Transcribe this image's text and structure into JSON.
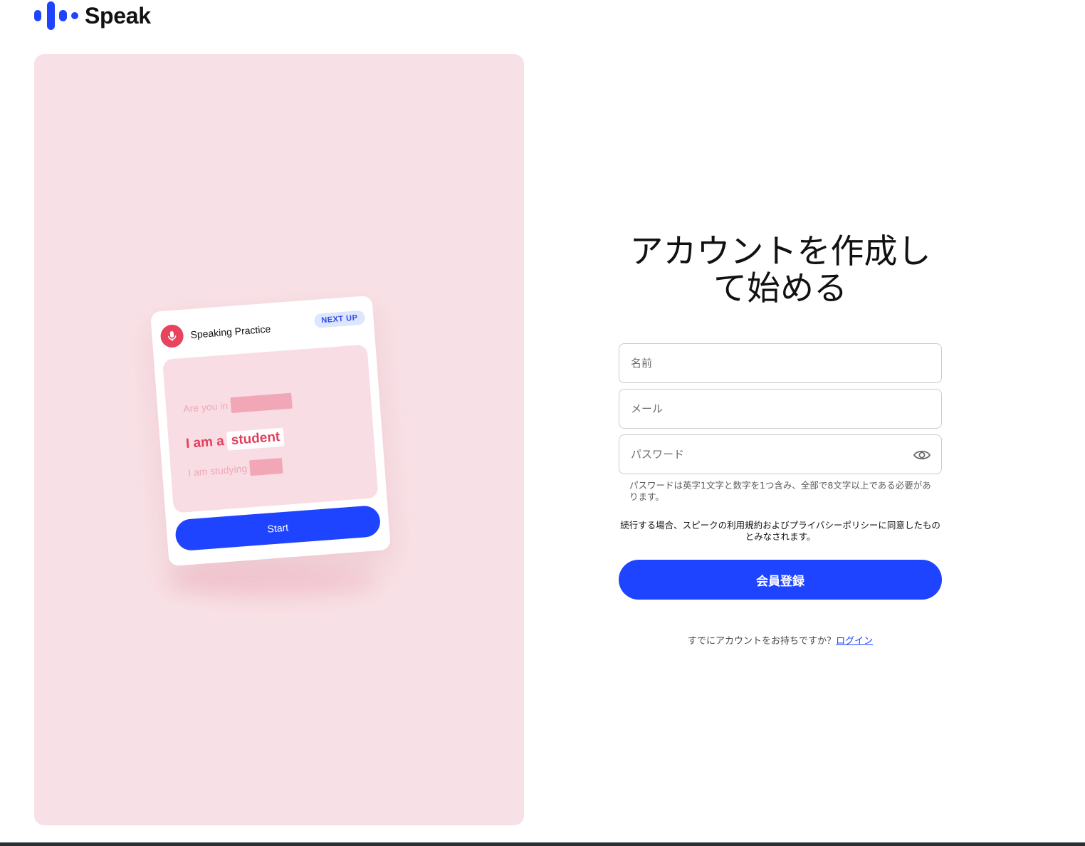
{
  "brand": {
    "name": "Speak",
    "color": "#1f44ff"
  },
  "promo": {
    "background": "#f8e1e6",
    "card": {
      "title": "Speaking Practice",
      "badge": "NEXT UP",
      "lines": [
        "Are you in",
        "I am a",
        "student",
        "I am studying"
      ],
      "start_label": "Start"
    }
  },
  "form": {
    "title": "アカウントを作成して始める",
    "name_placeholder": "名前",
    "email_placeholder": "メール",
    "password_placeholder": "パスワード",
    "password_hint": "パスワードは英字1文字と数字を1つ含み、全部で8文字以上である必要があります。",
    "terms": "続行する場合、スピークの利用規約およびプライバシーポリシーに同意したものとみなされます。",
    "register_label": "会員登録",
    "login_prompt": "すでにアカウントをお持ちですか？",
    "login_link": "ログイン"
  },
  "icons": {
    "password_toggle": "eye-icon",
    "card_icon": "microphone-icon"
  }
}
